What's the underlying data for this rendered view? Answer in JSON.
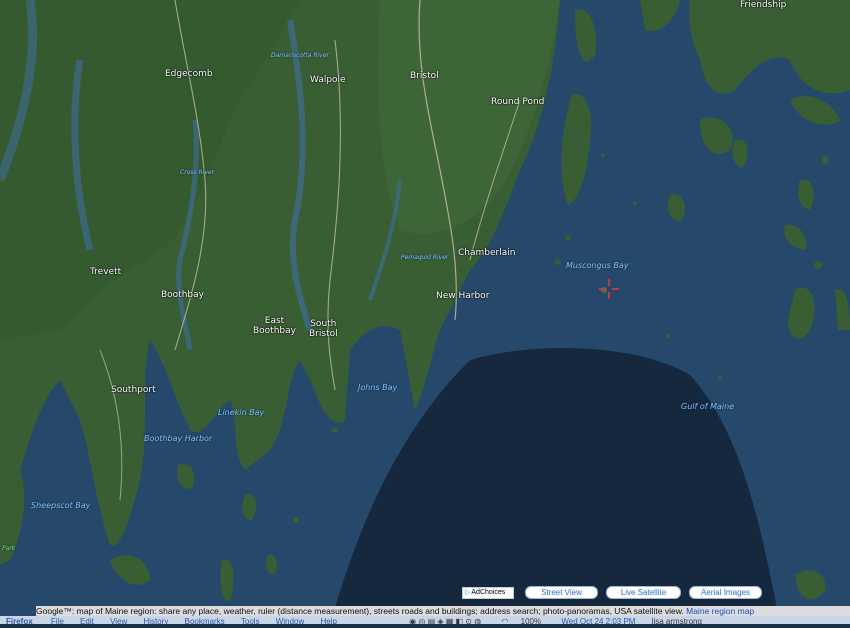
{
  "places": {
    "friendship": "Friendship",
    "edgecomb": "Edgecomb",
    "walpole": "Walpole",
    "bristol": "Bristol",
    "round_pond": "Round Pond",
    "trevett": "Trevett",
    "boothbay": "Boothbay",
    "east_boothbay": "East\nBoothbay",
    "south_bristol": "South\nBristol",
    "chamberlain": "Chamberlain",
    "new_harbor": "New Harbor",
    "southport": "Southport"
  },
  "water": {
    "damariscotta_river": "Damariscotta River",
    "cross_river": "Cross River",
    "pemaquid_river": "Pemaquid River",
    "muscongus_bay": "Muscongus Bay",
    "johns_bay": "Johns Bay",
    "gulf_of_maine": "Gulf of Maine",
    "linekin_bay": "Linekin Bay",
    "boothbay_harbor": "Boothbay Harbor",
    "sheepscot_bay": "Sheepscot Bay",
    "park": "Park"
  },
  "controls": {
    "adchoices": "AdChoices",
    "street_view": "Street View",
    "live_satellite": "Live Satellite",
    "aerial_images": "Aerial Images"
  },
  "footer": {
    "text": "Google™: map of Maine region: share any place, weather, ruler (distance measurement), streets roads and buildings; address search; photo-panoramas, USA satellite view. ",
    "link": "Maine region map"
  },
  "menubar": {
    "app": "Firefox",
    "items": [
      "File",
      "Edit",
      "View",
      "History",
      "Bookmarks",
      "Tools",
      "Window",
      "Help"
    ],
    "battery": "100%",
    "datetime": "Wed Oct 24  2:03 PM",
    "user": "lisa armstrong"
  },
  "colors": {
    "land": "#3a5e34",
    "shallow_water": "#25476a",
    "deep_water": "#15283e",
    "marker": "#e03a3a",
    "link": "#2a6fd8"
  }
}
